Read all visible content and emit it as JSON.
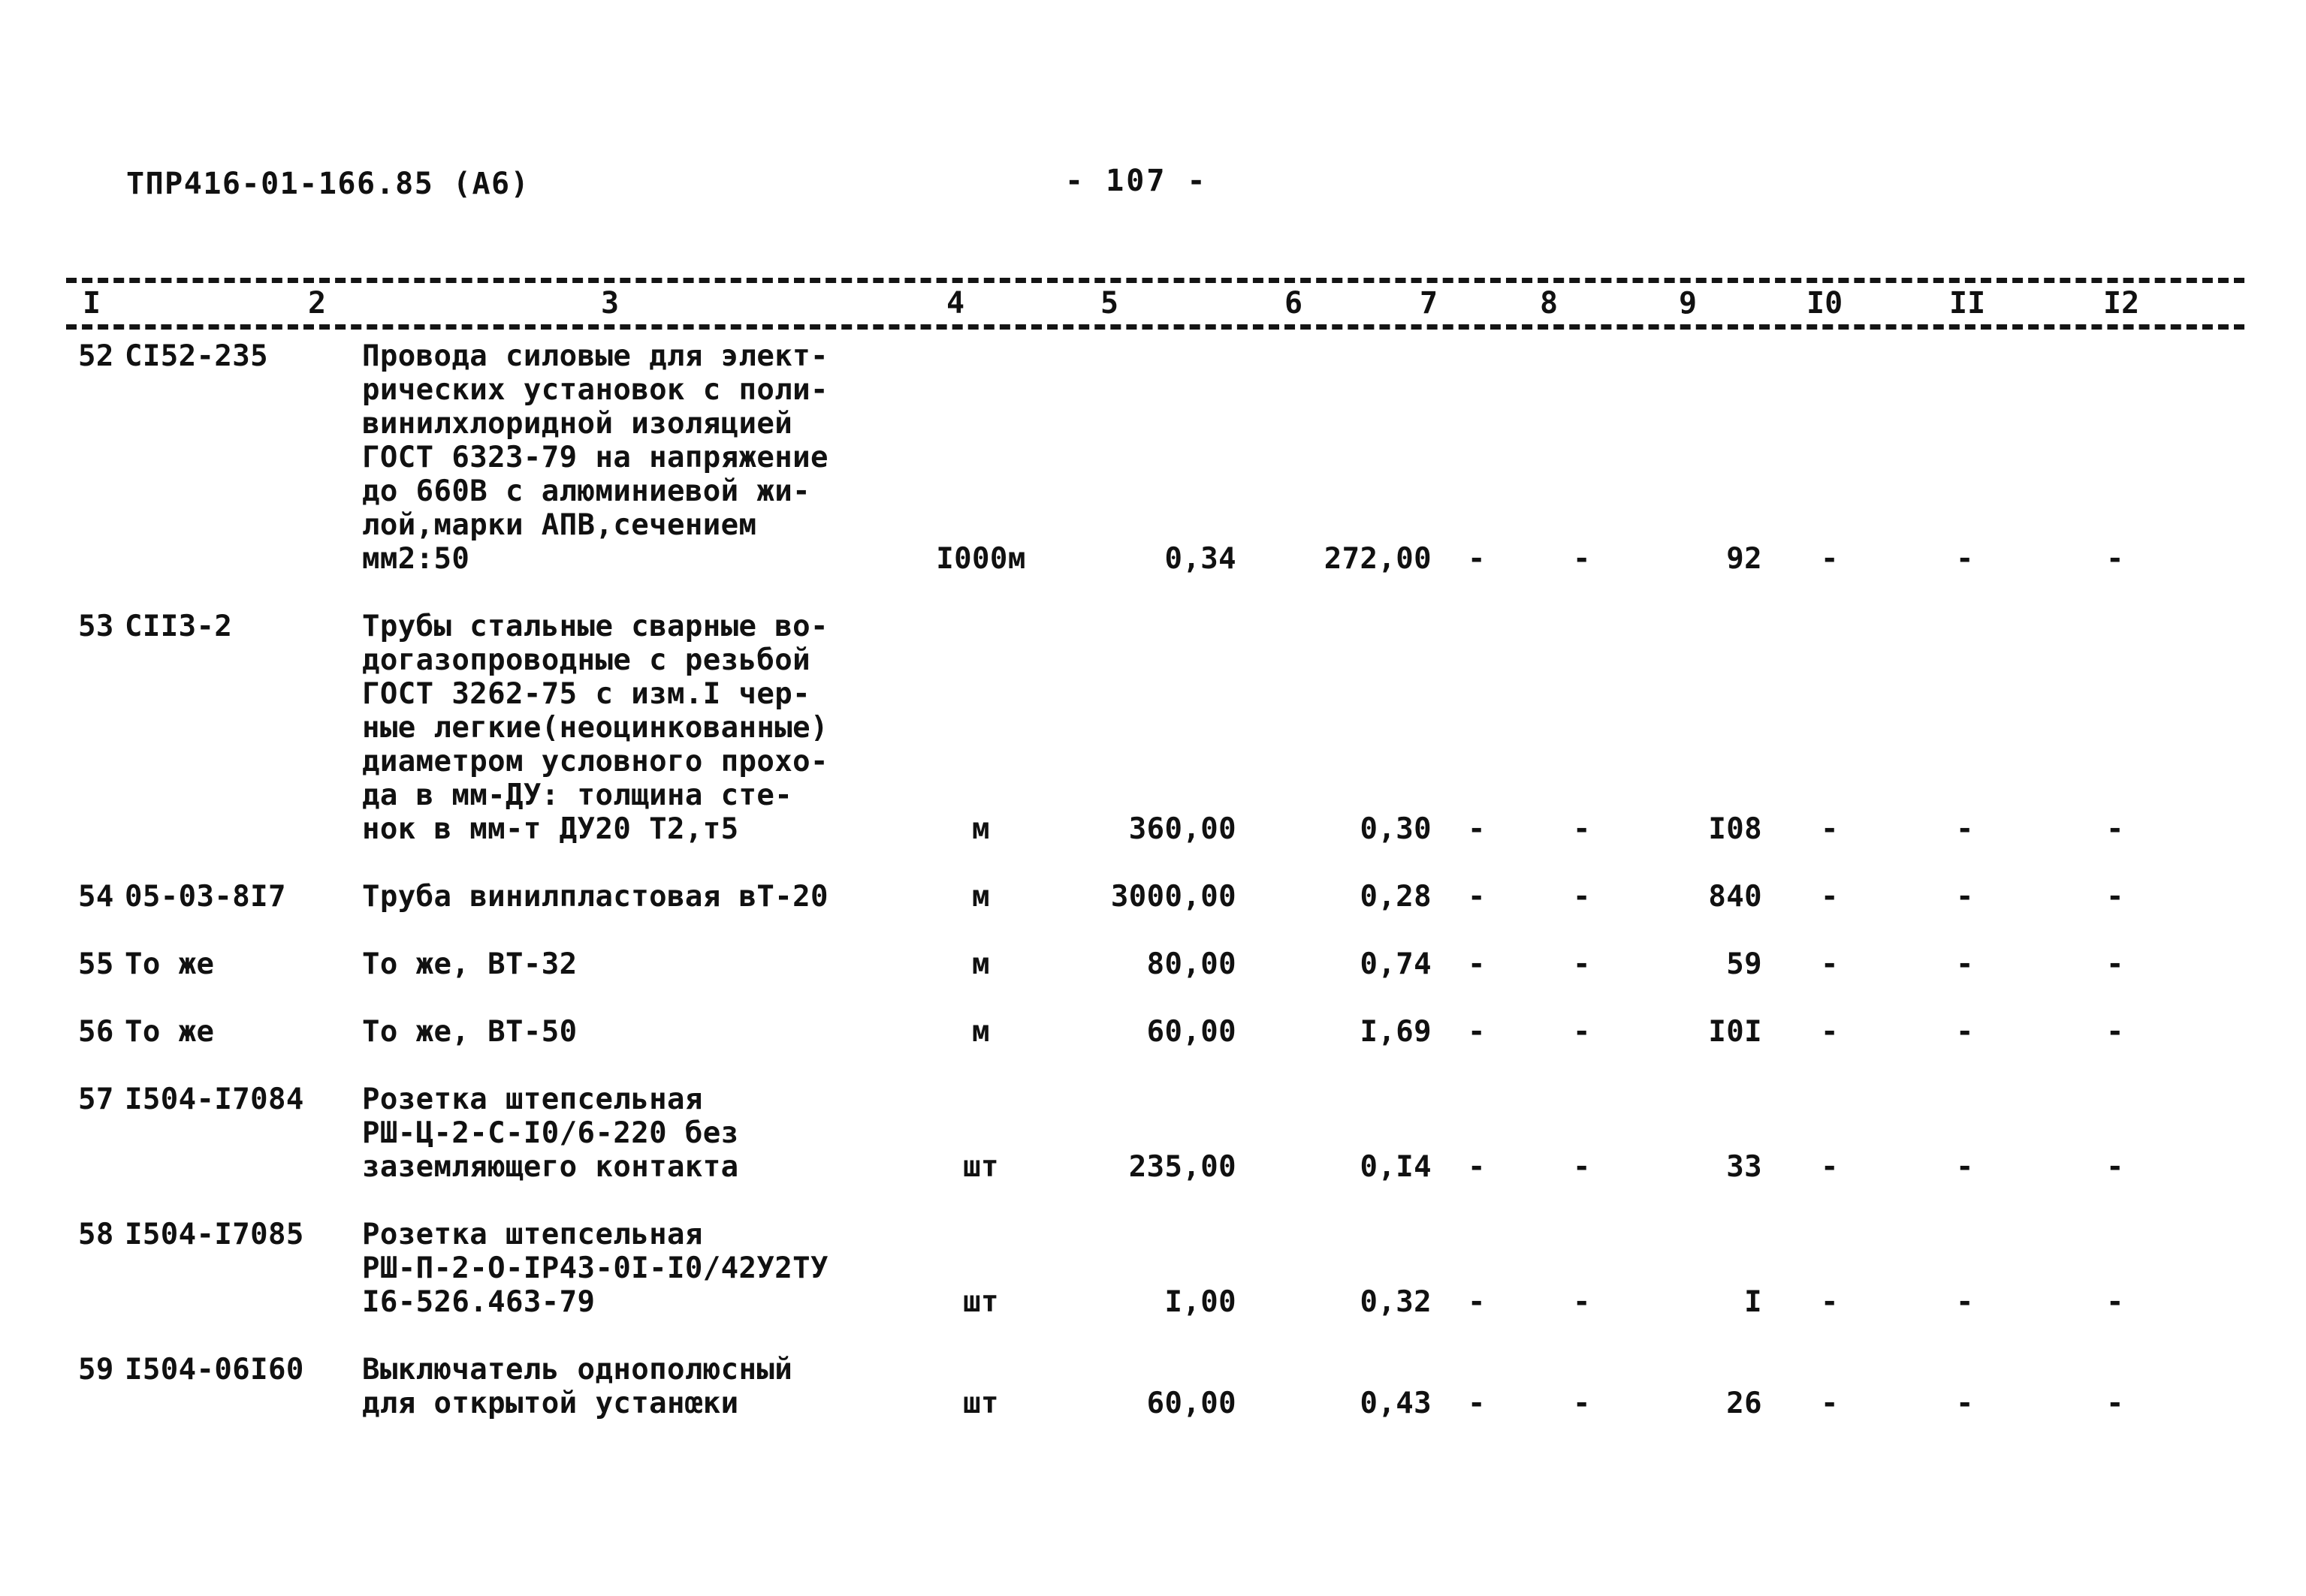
{
  "header": {
    "doc_code": "ТПР416-01-166.85 (А6)",
    "page_number": "- 107 -"
  },
  "table": {
    "column_numbers": [
      "I",
      "2",
      "3",
      "4",
      "5",
      "6",
      "7",
      "8",
      "9",
      "I0",
      "II",
      "I2"
    ],
    "rows": [
      {
        "num": "52",
        "code": "СI52-235",
        "name_lines": [
          "Провода силовые для элект-",
          "рических установок с поли-",
          "винилхлоридной изоляцией",
          "ГОСТ 6323-79 на напряжение",
          "до 660В с алюминиевой жи-",
          "лой,марки АПВ,сечением",
          "мм2:50"
        ],
        "unit": "I000м",
        "col5": "0,34",
        "col6": "272,00",
        "col7": "-",
        "col8": "-",
        "col9": "92",
        "col10": "-",
        "col11": "-",
        "col12": "-"
      },
      {
        "num": "53",
        "code": "СII3-2",
        "name_lines": [
          "Трубы стальные сварные во-",
          "догазопроводные с резьбой",
          "ГОСТ 3262-75 с изм.I чер-",
          "ные легкие(неоцинкованные)",
          "диаметром условного прохо-",
          "да в мм-ДУ: толщина сте-",
          "нок в мм-т ДУ20 Т2,т5"
        ],
        "unit": "м",
        "col5": "360,00",
        "col6": "0,30",
        "col7": "-",
        "col8": "-",
        "col9": "I08",
        "col10": "-",
        "col11": "-",
        "col12": "-"
      },
      {
        "num": "54",
        "code": "05-03-8I7",
        "name_lines": [
          "Труба винилпластовая вТ-20"
        ],
        "unit": "м",
        "col5": "3000,00",
        "col6": "0,28",
        "col7": "-",
        "col8": "-",
        "col9": "840",
        "col10": "-",
        "col11": "-",
        "col12": "-"
      },
      {
        "num": "55",
        "code": "То же",
        "name_lines": [
          "То же, ВТ-32"
        ],
        "unit": "м",
        "col5": "80,00",
        "col6": "0,74",
        "col7": "-",
        "col8": "-",
        "col9": "59",
        "col10": "-",
        "col11": "-",
        "col12": "-"
      },
      {
        "num": "56",
        "code": "То же",
        "name_lines": [
          "То же, ВТ-50"
        ],
        "unit": "м",
        "col5": "60,00",
        "col6": "I,69",
        "col7": "-",
        "col8": "-",
        "col9": "I0I",
        "col10": "-",
        "col11": "-",
        "col12": "-"
      },
      {
        "num": "57",
        "code": "I504-I7084",
        "name_lines": [
          "Розетка штепсельная",
          "РШ-Ц-2-С-I0/6-220 без",
          "заземляющего контакта"
        ],
        "unit": "шт",
        "col5": "235,00",
        "col6": "0,I4",
        "col7": "-",
        "col8": "-",
        "col9": "33",
        "col10": "-",
        "col11": "-",
        "col12": "-"
      },
      {
        "num": "58",
        "code": "I504-I7085",
        "name_lines": [
          "Розетка штепсельная",
          "РШ-П-2-О-IР43-0I-I0/42У2ТУ",
          "I6-526.463-79"
        ],
        "unit": "шт",
        "col5": "I,00",
        "col6": "0,32",
        "col7": "-",
        "col8": "-",
        "col9": "I",
        "col10": "-",
        "col11": "-",
        "col12": "-"
      },
      {
        "num": "59",
        "code": "I504-06I60",
        "name_lines": [
          "Выключатель однополюсный",
          "для открытой устанœки"
        ],
        "unit": "шт",
        "col5": "60,00",
        "col6": "0,43",
        "col7": "-",
        "col8": "-",
        "col9": "26",
        "col10": "-",
        "col11": "-",
        "col12": "-"
      }
    ]
  }
}
